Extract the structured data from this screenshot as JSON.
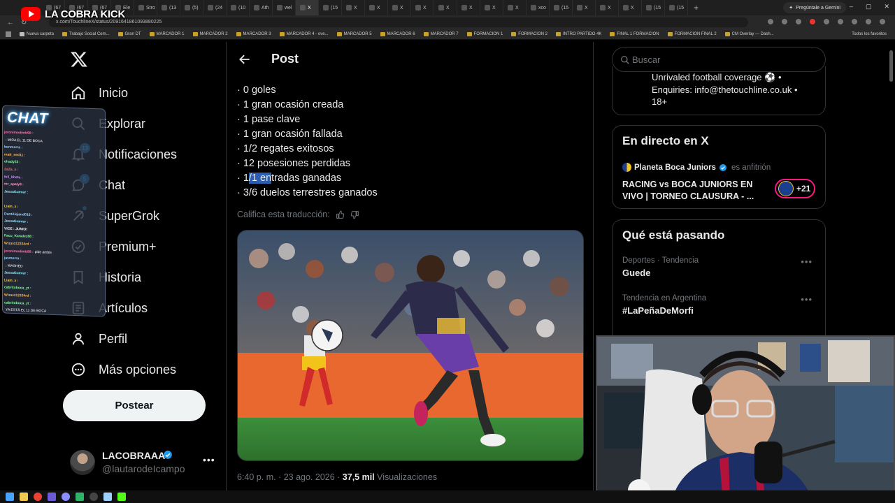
{
  "stream": {
    "channel_name": "LA COBRA KICK"
  },
  "browser": {
    "tabs": [
      {
        "label": "(67"
      },
      {
        "label": "(67"
      },
      {
        "label": "(67"
      },
      {
        "label": "Ele"
      },
      {
        "label": "Stro"
      },
      {
        "label": "(13"
      },
      {
        "label": "(5)"
      },
      {
        "label": "(24"
      },
      {
        "label": "(10"
      },
      {
        "label": "Ath"
      },
      {
        "label": "wel"
      },
      {
        "label": "X"
      },
      {
        "label": "(15"
      },
      {
        "label": "X"
      },
      {
        "label": "X"
      },
      {
        "label": "X"
      },
      {
        "label": "X"
      },
      {
        "label": "X"
      },
      {
        "label": "X"
      },
      {
        "label": "X"
      },
      {
        "label": "X"
      },
      {
        "label": "xco"
      },
      {
        "label": "(15"
      },
      {
        "label": "X"
      },
      {
        "label": "X"
      },
      {
        "label": "X"
      },
      {
        "label": "(15"
      },
      {
        "label": "(15"
      }
    ],
    "gemini_label": "Pregúntale a Gemini",
    "url": "x.com/TouchlineX/status/2091641861093880225",
    "bookmarks": [
      {
        "label": "Nueva carpeta",
        "kind": "folder"
      },
      {
        "label": "Trabajo Social Com...",
        "kind": "site"
      },
      {
        "label": "Gran DT",
        "kind": "site"
      },
      {
        "label": "MARCADOR 1",
        "kind": "site"
      },
      {
        "label": "MARCADOR 2",
        "kind": "site"
      },
      {
        "label": "MARCADOR 3",
        "kind": "site"
      },
      {
        "label": "MARCADOR 4 - ove...",
        "kind": "site"
      },
      {
        "label": "MARCADOR 5",
        "kind": "site"
      },
      {
        "label": "MARCADOR 6",
        "kind": "site"
      },
      {
        "label": "MARCADOR 7",
        "kind": "site"
      },
      {
        "label": "FORMACION 1",
        "kind": "site"
      },
      {
        "label": "FORMACION 2",
        "kind": "site"
      },
      {
        "label": "INTRO PARTIDO 4K",
        "kind": "site"
      },
      {
        "label": "FINAL 1 FORMACION",
        "kind": "site"
      },
      {
        "label": "FORMACION FINAL 2",
        "kind": "site"
      },
      {
        "label": "CM Overlay — Dash...",
        "kind": "site"
      }
    ],
    "bookmarks_all": "Todos los favoritos"
  },
  "sidebar": {
    "items": [
      {
        "label": "Inicio",
        "icon": "home-icon"
      },
      {
        "label": "Explorar",
        "icon": "search-icon"
      },
      {
        "label": "Notificaciones",
        "icon": "bell-icon",
        "badge": "13"
      },
      {
        "label": "Chat",
        "icon": "chat-icon",
        "badge": "5"
      },
      {
        "label": "SuperGrok",
        "icon": "grok-icon",
        "dot": true
      },
      {
        "label": "Premium+",
        "icon": "premium-icon"
      },
      {
        "label": "Historia",
        "icon": "bookmark-icon"
      },
      {
        "label": "Artículos",
        "icon": "articles-icon"
      },
      {
        "label": "Perfil",
        "icon": "person-icon"
      },
      {
        "label": "Más opciones",
        "icon": "more-icon"
      }
    ],
    "post_button": "Postear",
    "account": {
      "name": "LACOBRAAA",
      "handle": "@lautarodeIcampo"
    }
  },
  "chat_overlay": {
    "title": "CHAT",
    "messages": [
      {
        "user": "jeronimodimb98 :",
        "text": "",
        "color": "#ff6ea8"
      },
      {
        "user": "",
        "text": ": MIRA EL 11 DE BOCA",
        "color": "#ffd24a"
      },
      {
        "user": "benmorra :",
        "text": "",
        "color": "#9ad0ff"
      },
      {
        "user": "matt_eed11 :",
        "text": "",
        "color": "#ffb347"
      },
      {
        "user": "ohady23 :",
        "text": "",
        "color": "#7cff9a"
      },
      {
        "user": "ZaZa_x :",
        "text": "",
        "color": "#ff7070"
      },
      {
        "user": "feli_bheta :",
        "text": "",
        "color": "#d48bff"
      },
      {
        "user": "mr_apaly9 :",
        "text": "",
        "color": "#ff9ad0"
      },
      {
        "user": "JessaGuevar :",
        "text": "",
        "color": "#8ef"
      },
      {
        "user": "",
        "text": "",
        "color": "#ff6ea8"
      },
      {
        "user": "Liam_x :",
        "text": "",
        "color": "#ffd24a"
      },
      {
        "user": "DantAlejand016 :",
        "text": "",
        "color": "#9ad0ff"
      },
      {
        "user": "JessaGuevar :",
        "text": "",
        "color": "#8ef"
      },
      {
        "user": "VICE : JUNIO!",
        "text": "",
        "color": "#fff"
      },
      {
        "user": "Facu_Kanalez88 :",
        "text": "",
        "color": "#7cff9a"
      },
      {
        "user": "Wizard12334rd :",
        "text": "",
        "color": "#ffb347"
      },
      {
        "user": "jeronimodimb98 :",
        "text": "pide ambis",
        "color": "#ff6ea8"
      },
      {
        "user": "jasmorra :",
        "text": "",
        "color": "#9ad0ff"
      },
      {
        "user": "",
        "text": ": WASHED",
        "color": "#ff7070"
      },
      {
        "user": "JessaGuevar :",
        "text": "",
        "color": "#8ef"
      },
      {
        "user": "Liam_x :",
        "text": "",
        "color": "#ffd24a"
      },
      {
        "user": "cabritoboca_yt :",
        "text": "",
        "color": "#7cff9a"
      },
      {
        "user": "Wizard12334rd :",
        "text": "",
        "color": "#ffb347"
      },
      {
        "user": "cabritoboca_yt :",
        "text": "",
        "color": "#7cff9a"
      },
      {
        "user": "",
        "text": "YA ESTÁ EL 11 DE BOCA",
        "color": "#ff6ea8"
      },
      {
        "user": "Liam_x :",
        "text": "",
        "color": "#ffd24a"
      },
      {
        "user": "farSilHoom1 :",
        "text": "",
        "color": "#d48bff"
      },
      {
        "user": "Liam_x :",
        "text": "",
        "color": "#ffd24a"
      },
      {
        "user": "Ivick_p091 :",
        "text": "",
        "color": "#9ad0ff"
      }
    ]
  },
  "post": {
    "header_title": "Post",
    "stats": [
      "· 0 goles",
      "· 1 gran ocasión creada",
      "· 1 pase clave",
      "· 1 gran ocasión fallada",
      "· 1/2 regates exitosos",
      "· 12 posesiones perdidas",
      "· 1/1 entradas ganadas",
      "· 3/6 duelos terrestres ganados"
    ],
    "highlight": {
      "pre": "· 1",
      "sel": "/1 en",
      "post": "tradas ganadas"
    },
    "rate_label": "Califica esta traducción:",
    "meta_time": "6:40 p. m. · 23 ago. 2026 · ",
    "meta_views_count": "37,5 mil",
    "meta_views_label": " Visualizaciones"
  },
  "right": {
    "search_placeholder": "Buscar",
    "bio_lines": [
      "Unrivaled football coverage ⚽ •",
      "Enquiries: info@thetouchline.co.uk •",
      "18+"
    ],
    "live": {
      "title": "En directo en X",
      "host": "Planeta Boca Juniors",
      "role": "es anfitrión",
      "event": "RACING vs BOCA JUNIORS EN VIVO | TORNEO CLAUSURA - ...",
      "count": "+21"
    },
    "trends": {
      "title": "Qué está pasando",
      "items": [
        {
          "meta": "Deportes · Tendencia",
          "name": "Guede"
        },
        {
          "meta": "Tendencia en Argentina",
          "name": "#LaPeñaDeMorfi"
        }
      ]
    }
  },
  "colors": {
    "accent": "#1d9bf0",
    "live_ring": "#f91880",
    "background": "#000000"
  }
}
